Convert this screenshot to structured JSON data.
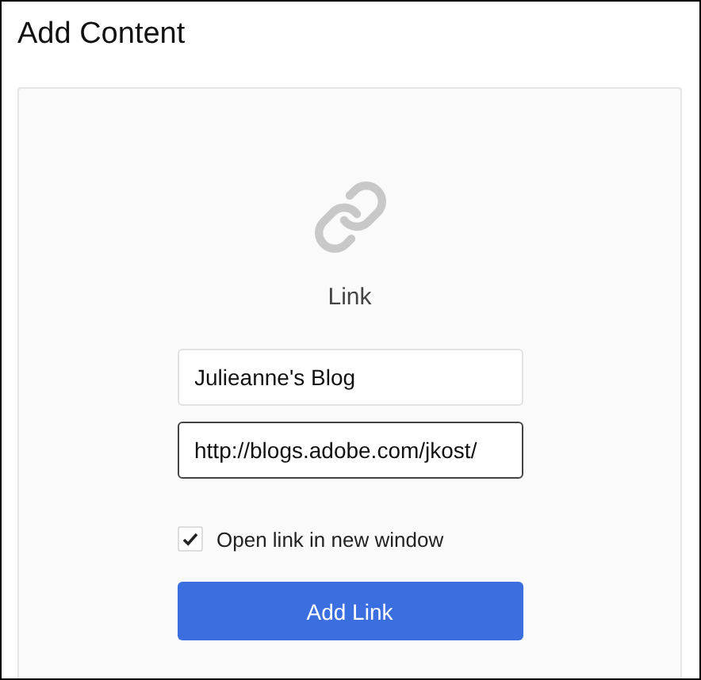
{
  "window": {
    "title": "Add Content"
  },
  "content_type": {
    "label": "Link"
  },
  "fields": [
    {
      "value": "Julieanne's Blog",
      "focused": false
    },
    {
      "value": "http://blogs.adobe.com/jkost/",
      "focused": true
    }
  ],
  "new_window_option": {
    "label": "Open link in new window",
    "checked": true
  },
  "submit_button": {
    "label": "Add Link"
  }
}
